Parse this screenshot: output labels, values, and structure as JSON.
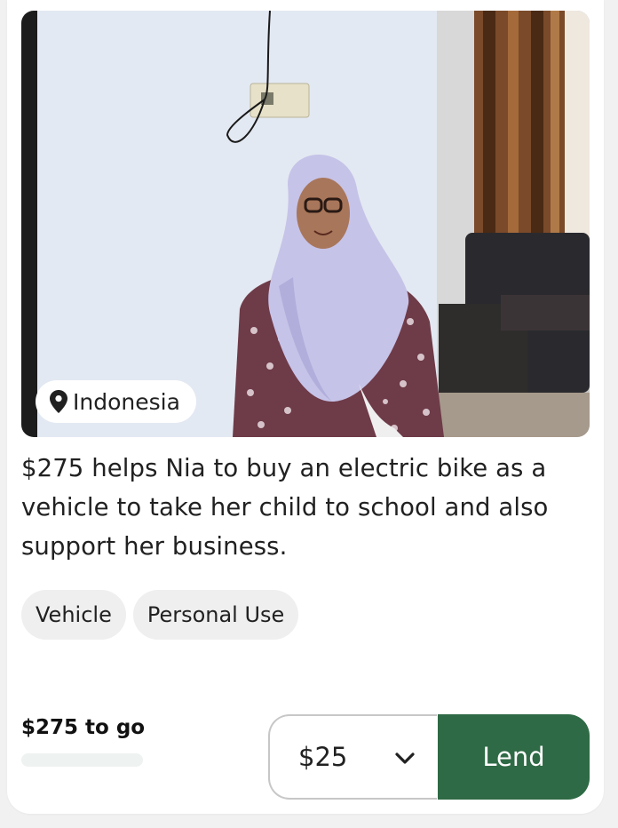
{
  "loan": {
    "location": "Indonesia",
    "description": "$275 helps Nia to buy an electric bike as a vehicle to take her child to school and also support her business.",
    "tags": [
      "Vehicle",
      "Personal Use"
    ],
    "remaining": "$275 to go",
    "funded_fraction": 0
  },
  "actions": {
    "amount": "$25",
    "lend_label": "Lend"
  },
  "icons": {
    "location": "map-pin-icon",
    "dropdown": "chevron-down-icon"
  },
  "colors": {
    "accent": "#2e6a45",
    "text": "#212121",
    "tag_bg": "#efefef"
  }
}
